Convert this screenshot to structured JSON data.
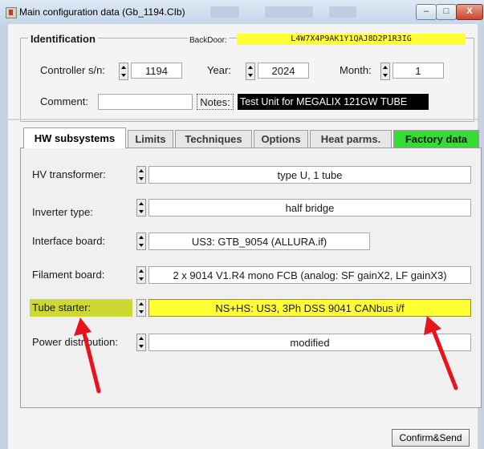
{
  "window": {
    "title": "Main configuration data (Gb_1194.CIb)",
    "minimize": "–",
    "maximize": "□",
    "close": "X"
  },
  "identification": {
    "legend": "Identification",
    "backdoor_label": "BackDoor:",
    "backdoor_value": "L4W7X4P9AK1Y1QAJ8D2P1R3IG",
    "controller_label": "Controller s/n:",
    "controller_value": "1194",
    "year_label": "Year:",
    "year_value": "2024",
    "month_label": "Month:",
    "month_value": "1",
    "comment_label": "Comment:",
    "comment_value": "",
    "notes_label": "Notes:",
    "notes_value": "Test Unit for MEGALIX 121GW TUBE"
  },
  "tabs": [
    {
      "label": "HW subsystems",
      "active": true
    },
    {
      "label": "Limits"
    },
    {
      "label": "Techniques"
    },
    {
      "label": "Options"
    },
    {
      "label": "Heat parms."
    },
    {
      "label": "Factory data",
      "color": "#33dd33"
    }
  ],
  "hw_subsystems": [
    {
      "label": "HV transformer:",
      "value": "type U, 1 tube"
    },
    {
      "label": "Inverter type:",
      "value": "half bridge"
    },
    {
      "label": "Interface board:",
      "value": "US3: GTB_9054 (ALLURA.if)"
    },
    {
      "label": "Filament board:",
      "value": "2 x 9014 V1.R4 mono FCB (analog: SF gainX2, LF gainX3)"
    },
    {
      "label": "Tube starter:",
      "value": "NS+HS: US3, 3Ph DSS 9041 CANbus i/f",
      "highlight": "#ffff33"
    },
    {
      "label": "Power distribution:",
      "value": "modified"
    }
  ],
  "footer": {
    "confirm_label": "Confirm&Send"
  },
  "colors": {
    "highlight": "#ffff33",
    "factory_tab": "#33dd33",
    "annotation_arrow": "#e8141b"
  }
}
